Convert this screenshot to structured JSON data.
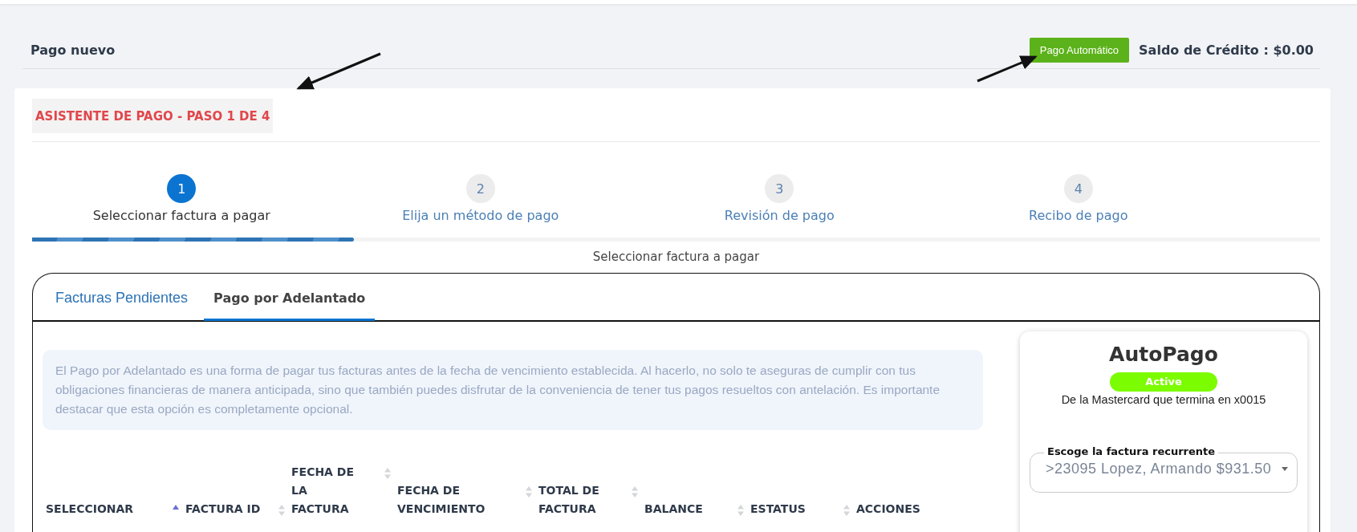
{
  "header": {
    "title": "Pago nuevo",
    "auto_pay_button": "Pago Automático",
    "credit_balance": "Saldo de Crédito : $0.00"
  },
  "wizard": {
    "title": "ASISTENTE DE PAGO - PASO 1 DE 4",
    "steps": [
      {
        "number": "1",
        "label": "Seleccionar factura a pagar",
        "selected": true
      },
      {
        "number": "2",
        "label": "Elija un método de pago",
        "selected": false
      },
      {
        "number": "3",
        "label": "Revisión de pago",
        "selected": false
      },
      {
        "number": "4",
        "label": "Recibo de pago",
        "selected": false
      }
    ],
    "progress": {
      "level": 0.25
    },
    "subtitle": "Seleccionar factura a pagar"
  },
  "tabs": [
    {
      "label": "Facturas Pendientes",
      "selected": false
    },
    {
      "label": "Pago por Adelantado",
      "selected": true
    }
  ],
  "info": "El Pago por Adelantado es una forma de pagar tus facturas antes de la fecha de vencimiento establecida. Al hacerlo, no solo te aseguras de cumplir con tus obligaciones financieras de manera anticipada, sino que también puedes disfrutar de la conveniencia de tener tus pagos resueltos con antelación. Es importante destacar que esta opción es completamente opcional.",
  "table": {
    "columns": [
      {
        "label": "SELECCIONAR",
        "sortable": true,
        "sorted": true
      },
      {
        "label": "FACTURA ID",
        "sortable": true,
        "sorted": false
      },
      {
        "label": "FECHA DE LA FACTURA",
        "sortable": true,
        "sorted": false
      },
      {
        "label": "FECHA DE VENCIMIENTO",
        "sortable": true,
        "sorted": false
      },
      {
        "label": "TOTAL DE FACTURA",
        "sortable": true,
        "sorted": false
      },
      {
        "label": "BALANCE",
        "sortable": true,
        "sorted": false
      },
      {
        "label": "ESTATUS",
        "sortable": true,
        "sorted": false
      },
      {
        "label": "ACCIONES",
        "sortable": false
      }
    ]
  },
  "autopay": {
    "title": "AutoPago",
    "status": "Active",
    "description": "De la Mastercard que termina en x0015",
    "field": {
      "label": "Escoge la factura recurrente",
      "value": ">23095 Lopez, Armando $931.50"
    }
  }
}
